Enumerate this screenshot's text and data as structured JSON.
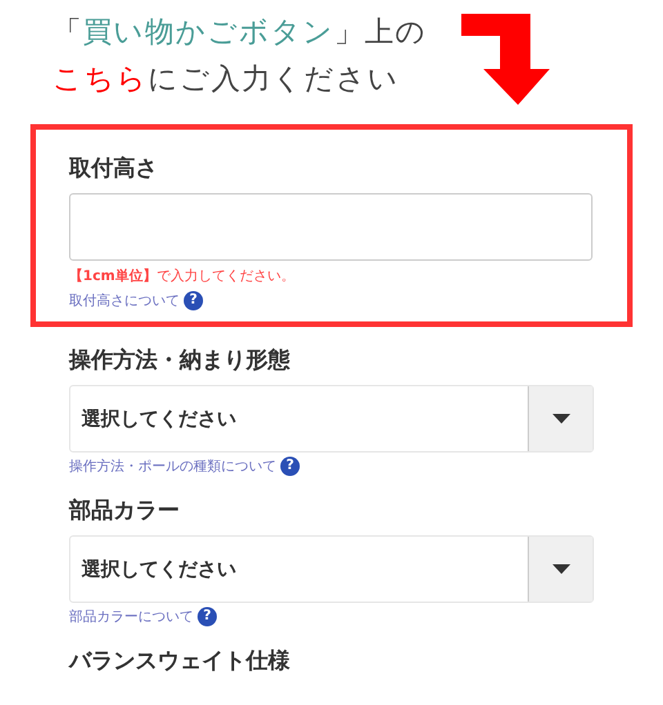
{
  "banner": {
    "lines": [
      [
        {
          "text": "「",
          "kind": "plain"
        },
        {
          "text": "買い物かごボタン",
          "kind": "accent"
        },
        {
          "text": "」上の",
          "kind": "plain"
        }
      ],
      [
        {
          "text": "こちら",
          "kind": "alert"
        },
        {
          "text": "にご入力ください",
          "kind": "plain"
        }
      ]
    ]
  },
  "fields": [
    {
      "kind": "text",
      "label": "取付高さ",
      "highlighted": true,
      "note": "**【1cm単位】**で入力してください。",
      "help": "取付高さについて",
      "help_icon": "?"
    },
    {
      "kind": "select",
      "label": "操作方法・納まり形態",
      "highlighted": false,
      "value": "選択してください",
      "help": "操作方法・ポールの種類について",
      "help_icon": "?"
    },
    {
      "kind": "select",
      "label": "部品カラー",
      "highlighted": false,
      "value": "選択してください",
      "help": "部品カラーについて",
      "help_icon": "?"
    },
    {
      "kind": "label",
      "label": "バランスウェイト仕様",
      "highlighted": false
    }
  ]
}
